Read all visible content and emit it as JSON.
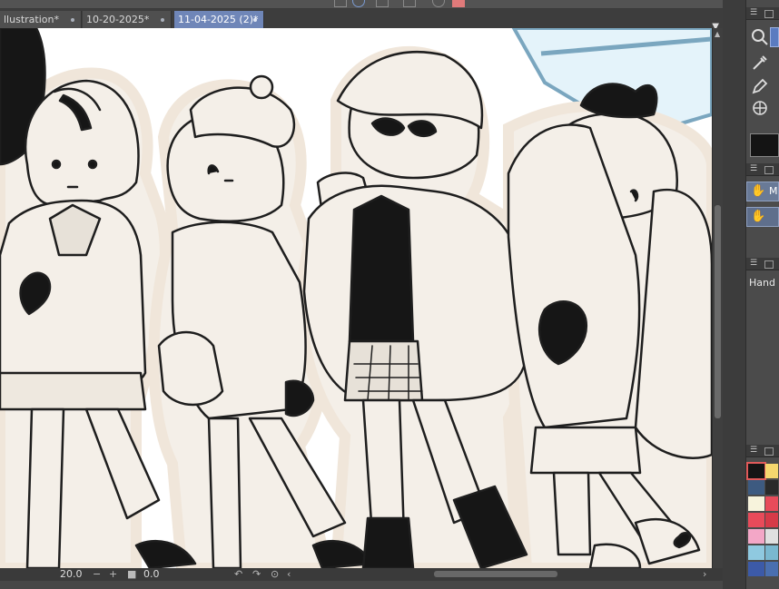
{
  "tabs": [
    {
      "label": "llustration*",
      "active": false
    },
    {
      "label": "10-20-2025*",
      "active": false
    },
    {
      "label": "11-04-2025 (2)*",
      "active": true
    }
  ],
  "status": {
    "zoom_value": "20.0",
    "angle_value": "0.0"
  },
  "panel": {
    "layer_letter": "M",
    "tool_label": "Hand"
  },
  "icons": [
    "zoom-icon",
    "eyedropper-icon",
    "pen-icon",
    "globe-icon",
    "hand-icon"
  ],
  "palette_colors": [
    "#141414",
    "#f5d76e",
    "#3d5a80",
    "#2a2a2a",
    "#f7f3dc",
    "#e84b5a",
    "#e84b5a",
    "#d63a48",
    "#f3a7c7",
    "#e0e0e0",
    "#8fc9e0",
    "#7ab8d0",
    "#3c5aa8",
    "#4a6fb0"
  ]
}
